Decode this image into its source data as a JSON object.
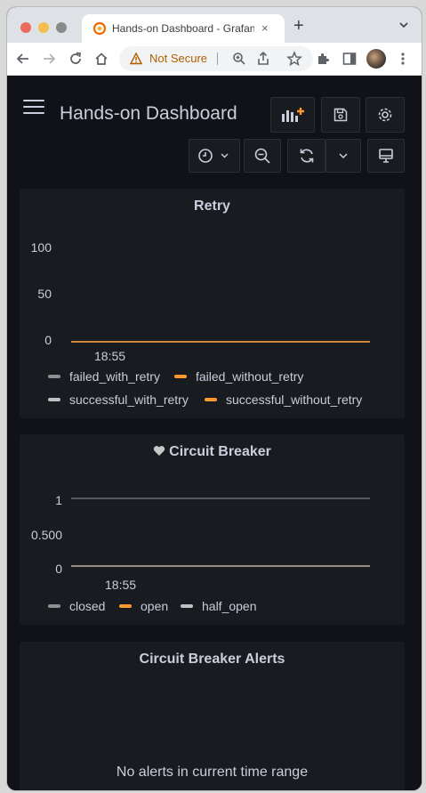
{
  "browser": {
    "tab_title": "Hands-on Dashboard - Grafana",
    "tab_close": "×",
    "new_tab": "+",
    "security_label": "Not Secure"
  },
  "dashboard": {
    "title": "Hands-on Dashboard"
  },
  "panels": {
    "retry": {
      "title": "Retry",
      "legend": [
        "failed_with_retry",
        "failed_without_retry",
        "successful_with_retry",
        "successful_without_retry"
      ]
    },
    "circuit_breaker": {
      "title": "Circuit Breaker",
      "legend": [
        "closed",
        "open",
        "half_open"
      ]
    },
    "alerts": {
      "title": "Circuit Breaker Alerts",
      "empty_message": "No alerts in current time range"
    }
  },
  "colors": {
    "series_gray": "#8e8e8e",
    "series_orange": "#ff9830",
    "series_light": "#c0c0c0",
    "panel_bg": "#181b1f",
    "page_bg": "#111217",
    "text": "#ccccdc"
  },
  "chart_data": [
    {
      "type": "line",
      "title": "Retry",
      "x": [
        "18:55"
      ],
      "y_ticks": [
        "100",
        "50",
        "0"
      ],
      "ylim": [
        0,
        100
      ],
      "series": [
        {
          "name": "failed_with_retry",
          "values": [
            0
          ]
        },
        {
          "name": "failed_without_retry",
          "values": [
            0
          ]
        },
        {
          "name": "successful_with_retry",
          "values": [
            0
          ]
        },
        {
          "name": "successful_without_retry",
          "values": [
            0
          ]
        }
      ],
      "legend": "bottom"
    },
    {
      "type": "line",
      "title": "Circuit Breaker",
      "x": [
        "18:55"
      ],
      "y_ticks": [
        "1",
        "0.500",
        "0"
      ],
      "ylim": [
        0,
        1
      ],
      "series": [
        {
          "name": "closed",
          "values": [
            1
          ]
        },
        {
          "name": "open",
          "values": [
            0
          ]
        },
        {
          "name": "half_open",
          "values": [
            0
          ]
        }
      ],
      "legend": "bottom"
    }
  ]
}
